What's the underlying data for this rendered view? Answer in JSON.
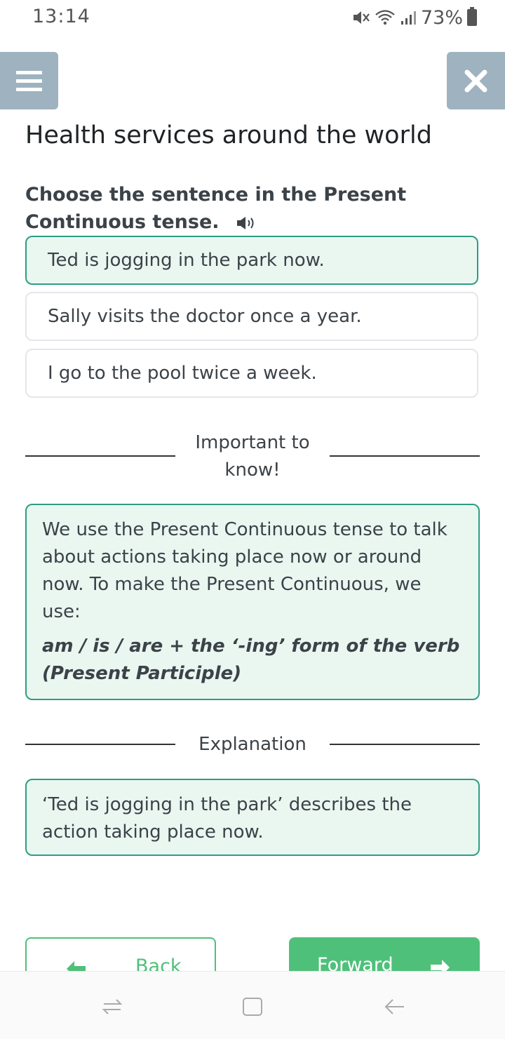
{
  "status_bar": {
    "time": "13:14",
    "battery_percent": "73%",
    "icons": [
      "mute-icon",
      "wifi-icon",
      "signal-icon",
      "battery-icon"
    ]
  },
  "header": {
    "menu_icon": "hamburger-menu-icon",
    "close_icon": "close-icon",
    "title": "Health services around the world"
  },
  "question": {
    "text": "Choose the sentence in the Present Continuous tense.",
    "audio_icon": "speaker-icon"
  },
  "options": [
    {
      "text": "Ted is jogging in the park now.",
      "selected": true
    },
    {
      "text": "Sally visits the doctor once a year.",
      "selected": false
    },
    {
      "text": "I go to the pool twice a week.",
      "selected": false
    }
  ],
  "important": {
    "heading": "Important to know!",
    "body": "We use the Present Continuous tense to talk about actions taking place now or around now. To make the Present Continuous, we use:",
    "formula": "am / is / are + the ‘-ing’ form of the verb (Present Participle)"
  },
  "explanation": {
    "heading": "Explanation",
    "body": "‘Ted is jogging in the park’ describes the action taking place now."
  },
  "navigation": {
    "back_label": "Back",
    "forward_label": "Forward"
  },
  "colors": {
    "accent_teal": "#2d9d84",
    "accent_green": "#4fc07a",
    "panel_bg": "#eaf7f1",
    "header_button_bg": "#9eb2bf"
  }
}
